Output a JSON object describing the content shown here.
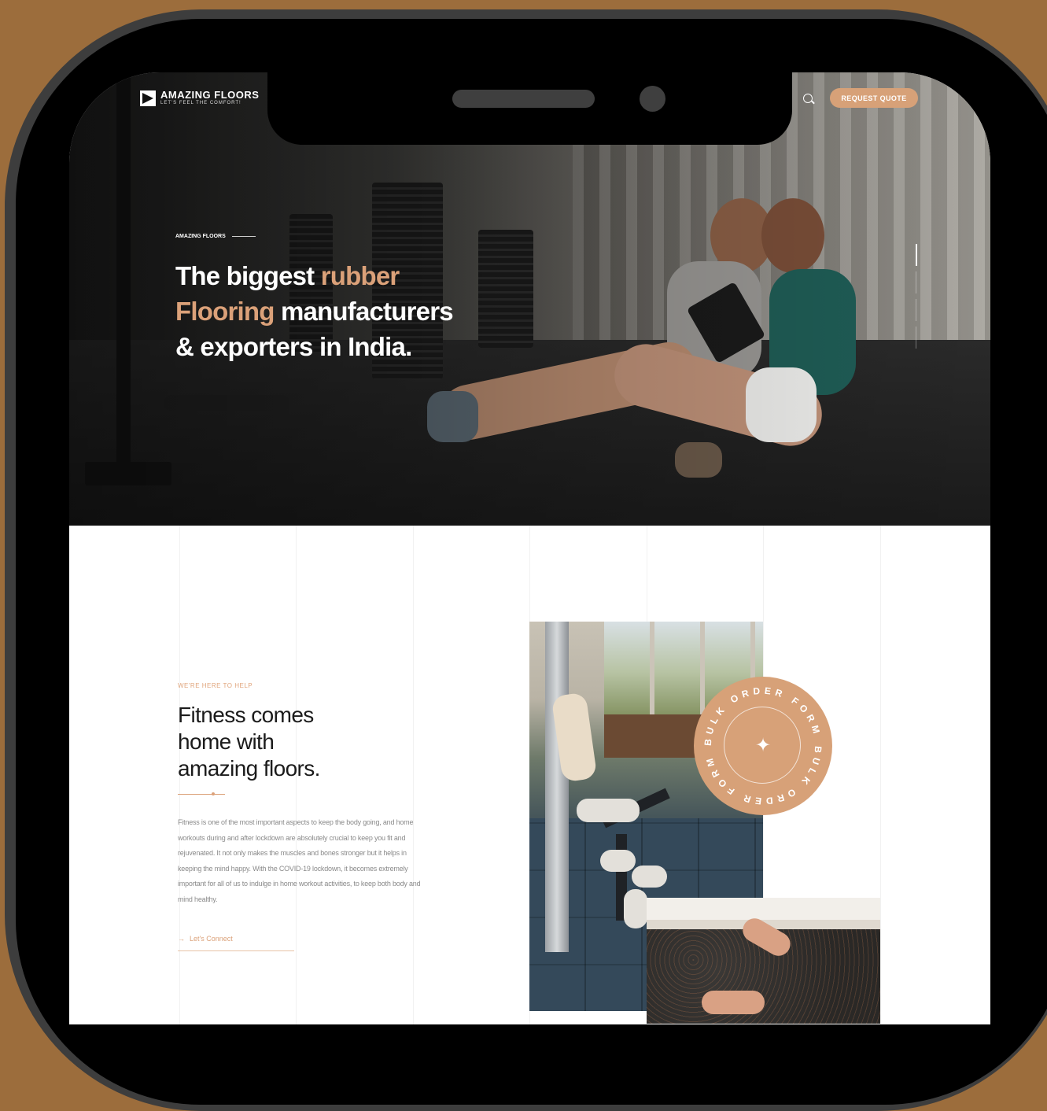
{
  "header": {
    "logo_name": "AMAZING FLOORS",
    "logo_tagline": "LET'S FEEL THE COMFORT!",
    "request_quote_label": "REQUEST QUOTE",
    "search_icon": "search-icon"
  },
  "hero": {
    "eyebrow": "AMAZING FLOORS",
    "headline_line1_start": "The biggest ",
    "headline_line1_accent": "rubber",
    "headline_line2_accent": "Flooring",
    "headline_line2_end": " manufacturers",
    "headline_line3": "& exporters in India.",
    "slides_total": 4,
    "slide_active": 1
  },
  "about": {
    "label": "WE'RE HERE TO HELP",
    "title_line1": "Fitness comes",
    "title_line2": "home with",
    "title_line3": "amazing floors.",
    "body": "Fitness is one of the most important aspects to keep the body going, and home workouts during and after lockdown are absolutely crucial to keep you fit and rejuvenated. It not only makes the muscles and bones stronger but it helps in keeping the mind happy. With the COVID-19 lockdown, it becomes extremely important for all of us to indulge in home workout activities, to keep both body and mind healthy.",
    "cta_label": "Let's Connect",
    "badge_text": "BULK ORDER FORM"
  },
  "colors": {
    "accent": "#dba179",
    "button": "#d7a178",
    "page_background": "#9c6d3c",
    "phone_bezel": "#000000"
  }
}
